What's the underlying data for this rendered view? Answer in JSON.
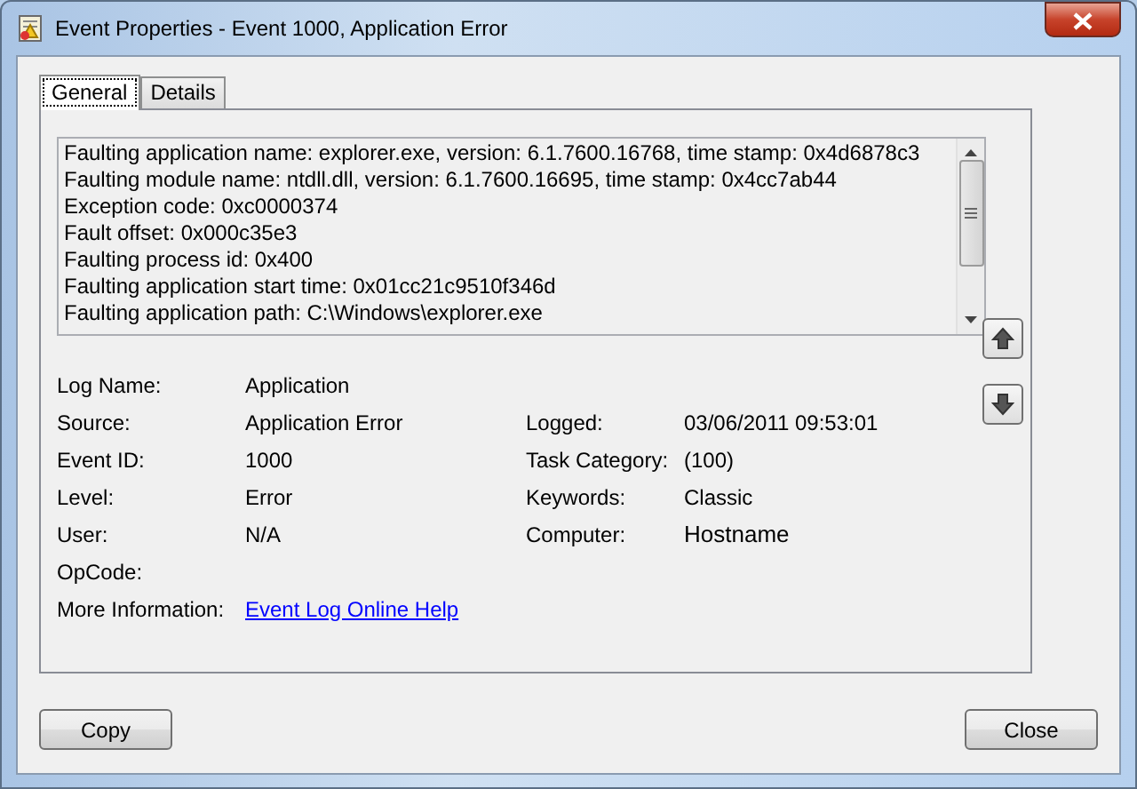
{
  "window": {
    "title": "Event Properties - Event 1000, Application Error"
  },
  "tabs": [
    {
      "label": "General",
      "selected": true
    },
    {
      "label": "Details",
      "selected": false
    }
  ],
  "description": [
    "Faulting application name: explorer.exe, version: 6.1.7600.16768, time stamp: 0x4d6878c3",
    "Faulting module name: ntdll.dll, version: 6.1.7600.16695, time stamp: 0x4cc7ab44",
    "Exception code: 0xc0000374",
    "Fault offset: 0x000c35e3",
    "Faulting process id: 0x400",
    "Faulting application start time: 0x01cc21c9510f346d",
    "Faulting application path: C:\\Windows\\explorer.exe"
  ],
  "rows": [
    {
      "label": "Log Name:",
      "value": "Application"
    },
    {
      "label": "Source:",
      "value": "Application Error",
      "label_2": "Logged:",
      "value_2": "03/06/2011 09:53:01"
    },
    {
      "label": "Event ID:",
      "value": "1000",
      "label_2": "Task Category:",
      "value_2": "(100)"
    },
    {
      "label": "Level:",
      "value": "Error",
      "label_2": "Keywords:",
      "value_2": "Classic"
    },
    {
      "label": "User:",
      "value": "N/A",
      "label_2": "Computer:",
      "value_2": "Hostname"
    },
    {
      "label": "OpCode:"
    }
  ],
  "more_information": {
    "label": "More Information:",
    "link": "Event Log Online Help"
  },
  "buttons": [
    "Copy",
    "Close"
  ]
}
